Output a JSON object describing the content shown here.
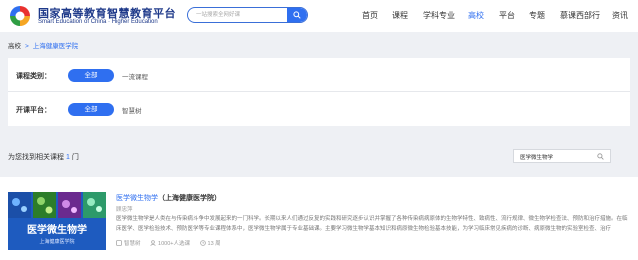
{
  "header": {
    "brand_cn": "国家高等教育智慧教育平台",
    "brand_en": "Smart Education of China · Higher Education",
    "search_placeholder": "一站搜索全网好课",
    "nav": [
      "首页",
      "课程",
      "学科专业",
      "高校",
      "平台",
      "专题",
      "慕课西部行",
      "资讯"
    ],
    "active_nav": "高校"
  },
  "breadcrumb": {
    "home": "高校",
    "separator": ">",
    "current": "上海健康医学院"
  },
  "filters": [
    {
      "label": "课程类别：",
      "selected": "全部",
      "option": "一流课程"
    },
    {
      "label": "开课平台：",
      "selected": "全部",
      "option": "智慧树"
    }
  ],
  "results": {
    "prefix": "为您找到相关课程",
    "count": "1",
    "suffix": "门",
    "search_value": "医学微生物学"
  },
  "course": {
    "title": "医学微生物学",
    "school_suffix": "（上海健康医学院）",
    "teacher": "顾忠萍",
    "description": "医学微生物学是人类在与传染病斗争中发展起来的一门科学。长期以来人们通过反复的实践和研究逐步认识并掌握了各种传染病病原体的生物学特性、致病性、流行规律、微生物学检查法、预防和治疗措施。在临床医学、医学检验技术、预防医学等专业课程体系中，医学微生物学属于专业基础课。主要学习微生物学基本知识和病原微生物检验基本技能，为学习临床常见疾病的诊断、病原微生物的实验室检查、治疗",
    "thumb_title": "医学微生物学",
    "thumb_sub": "上海健康医学院",
    "platform": "智慧树",
    "students": "1000+人选课",
    "weeks": "13 周"
  },
  "colors": {
    "accent": "#2f6ff0",
    "brand": "#1f3a8a"
  },
  "icons": [
    "logo-icon",
    "search-icon",
    "chevron-right-icon",
    "platform-icon",
    "people-icon",
    "clock-icon"
  ]
}
